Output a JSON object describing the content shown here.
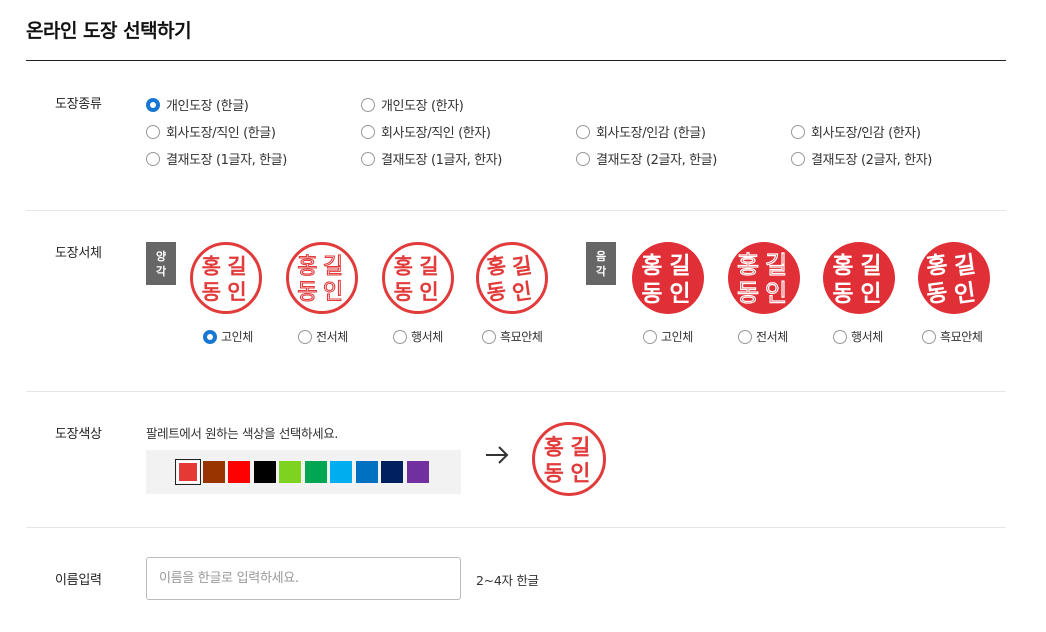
{
  "title": "온라인 도장 선택하기",
  "type_section": {
    "label": "도장종류",
    "options": [
      {
        "label": "개인도장 (한글)",
        "selected": true
      },
      {
        "label": "개인도장 (한자)",
        "selected": false
      },
      {
        "label": "회사도장/직인 (한글)",
        "selected": false
      },
      {
        "label": "회사도장/직인 (한자)",
        "selected": false
      },
      {
        "label": "회사도장/인감 (한글)",
        "selected": false
      },
      {
        "label": "회사도장/인감 (한자)",
        "selected": false
      },
      {
        "label": "결재도장 (1글자, 한글)",
        "selected": false
      },
      {
        "label": "결재도장 (1글자, 한자)",
        "selected": false
      },
      {
        "label": "결재도장 (2글자, 한글)",
        "selected": false
      },
      {
        "label": "결재도장 (2글자, 한자)",
        "selected": false
      }
    ]
  },
  "font_section": {
    "label": "도장서체",
    "positive_tag": [
      "양",
      "각"
    ],
    "negative_tag": [
      "음",
      "각"
    ],
    "seal_text": [
      "홍",
      "길",
      "동",
      "인"
    ],
    "positive_fonts": [
      {
        "label": "고인체",
        "selected": true
      },
      {
        "label": "전서체",
        "selected": false
      },
      {
        "label": "행서체",
        "selected": false
      },
      {
        "label": "흑묘안체",
        "selected": false
      }
    ],
    "negative_fonts": [
      {
        "label": "고인체",
        "selected": false
      },
      {
        "label": "전서체",
        "selected": false
      },
      {
        "label": "행서체",
        "selected": false
      },
      {
        "label": "흑묘안체",
        "selected": false
      }
    ]
  },
  "color_section": {
    "label": "도장색상",
    "helper": "팔레트에서 원하는 색상을 선택하세요.",
    "swatches": [
      "#e53935",
      "#993300",
      "#ff0000",
      "#000000",
      "#7ed321",
      "#00a651",
      "#00aeef",
      "#0070c0",
      "#002060",
      "#7030a0"
    ],
    "selected_index": 0,
    "preview_color": "#e23b3b"
  },
  "name_section": {
    "label": "이름입력",
    "placeholder": "이름을 한글로 입력하세요.",
    "hint": "2~4자 한글"
  }
}
